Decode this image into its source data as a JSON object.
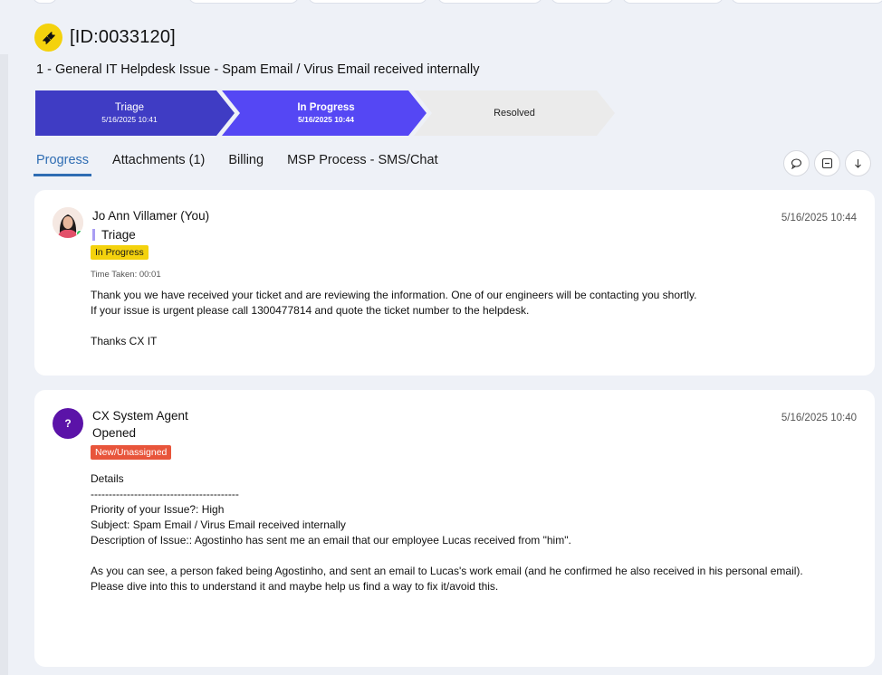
{
  "ticket": {
    "id_label": "[ID:0033120]",
    "subject": "1 - General IT Helpdesk Issue - Spam Email / Virus Email received internally"
  },
  "stages": [
    {
      "label": "Triage",
      "date": "5/16/2025 10:41"
    },
    {
      "label": "In Progress",
      "date": "5/16/2025 10:44"
    },
    {
      "label": "Resolved",
      "date": ""
    }
  ],
  "tabs": [
    {
      "label": "Progress"
    },
    {
      "label": "Attachments (1)"
    },
    {
      "label": "Billing"
    },
    {
      "label": "MSP Process - SMS/Chat"
    }
  ],
  "toolbar": {
    "icons": [
      "comment-icon",
      "collapse-icon",
      "arrow-down-icon"
    ]
  },
  "entries": [
    {
      "author": "Jo Ann Villamer (You)",
      "stage": "Triage",
      "status": "In Progress",
      "time_taken": "Time Taken: 00:01",
      "timestamp": "5/16/2025 10:44",
      "body": "Thank you we have received your ticket and are reviewing the information. One of our engineers will be contacting you shortly.\nIf your issue is urgent please call 1300477814 and quote the ticket number to the helpdesk.\n\nThanks CX IT"
    },
    {
      "author": "CX System Agent",
      "avatar_letter": "?",
      "stage": "Opened",
      "status": "New/Unassigned",
      "timestamp": "5/16/2025 10:40",
      "body": "Details\n-----------------------------------------\nPriority of your Issue?: High\nSubject: Spam Email / Virus Email received internally\nDescription of Issue:: Agostinho has sent me an email that our employee Lucas received from \"him\".\n\nAs you can see, a person faked being Agostinho, and sent an email to Lucas's work email (and he confirmed he also received in his personal email).\nPlease dive into this to understand it and maybe help us find a way to fix it/avoid this."
    }
  ],
  "colors": {
    "brand_yellow": "#f4d20d",
    "stage_done": "#3f3cc4",
    "stage_current": "#5547f4",
    "tab_active": "#2f6db3",
    "badge_new": "#e8553b"
  }
}
